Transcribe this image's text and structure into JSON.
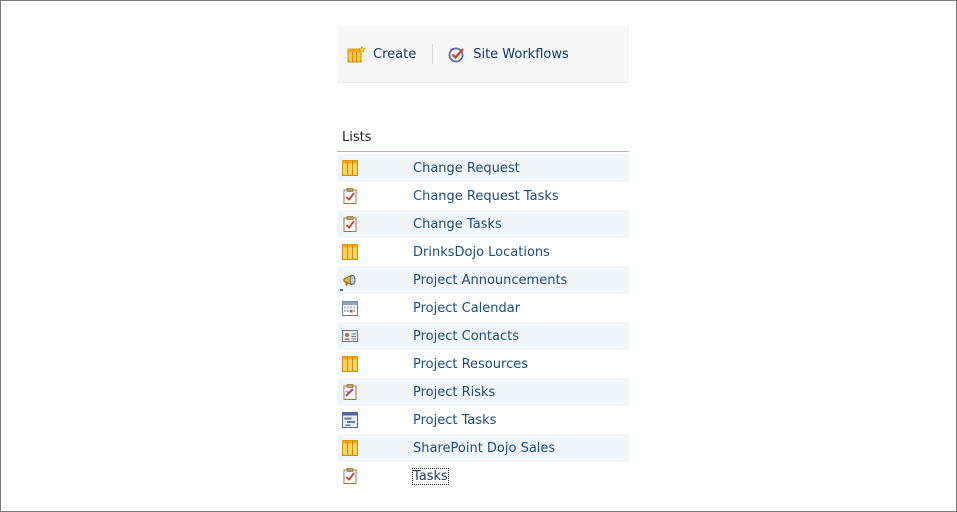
{
  "toolbar": {
    "create_label": "Create",
    "workflows_label": "Site Workflows"
  },
  "lists_header": "Lists",
  "lists": [
    {
      "label": "Change Request",
      "icon": "list-icon"
    },
    {
      "label": "Change Request Tasks",
      "icon": "tasks-icon"
    },
    {
      "label": "Change Tasks",
      "icon": "tasks-icon"
    },
    {
      "label": "DrinksDojo Locations",
      "icon": "list-icon"
    },
    {
      "label": "Project Announcements",
      "icon": "announcement-icon"
    },
    {
      "label": "Project Calendar",
      "icon": "calendar-icon"
    },
    {
      "label": "Project Contacts",
      "icon": "contacts-icon"
    },
    {
      "label": "Project Resources",
      "icon": "list-icon"
    },
    {
      "label": "Project Risks",
      "icon": "issues-icon"
    },
    {
      "label": "Project Tasks",
      "icon": "project-tasks-icon"
    },
    {
      "label": "SharePoint Dojo Sales",
      "icon": "list-icon"
    },
    {
      "label": "Tasks",
      "icon": "tasks-icon"
    }
  ],
  "colors": {
    "link": "#1f4d7a",
    "alt_row": "#f1f6fb",
    "toolbar_bg": "#f7f7f7"
  }
}
